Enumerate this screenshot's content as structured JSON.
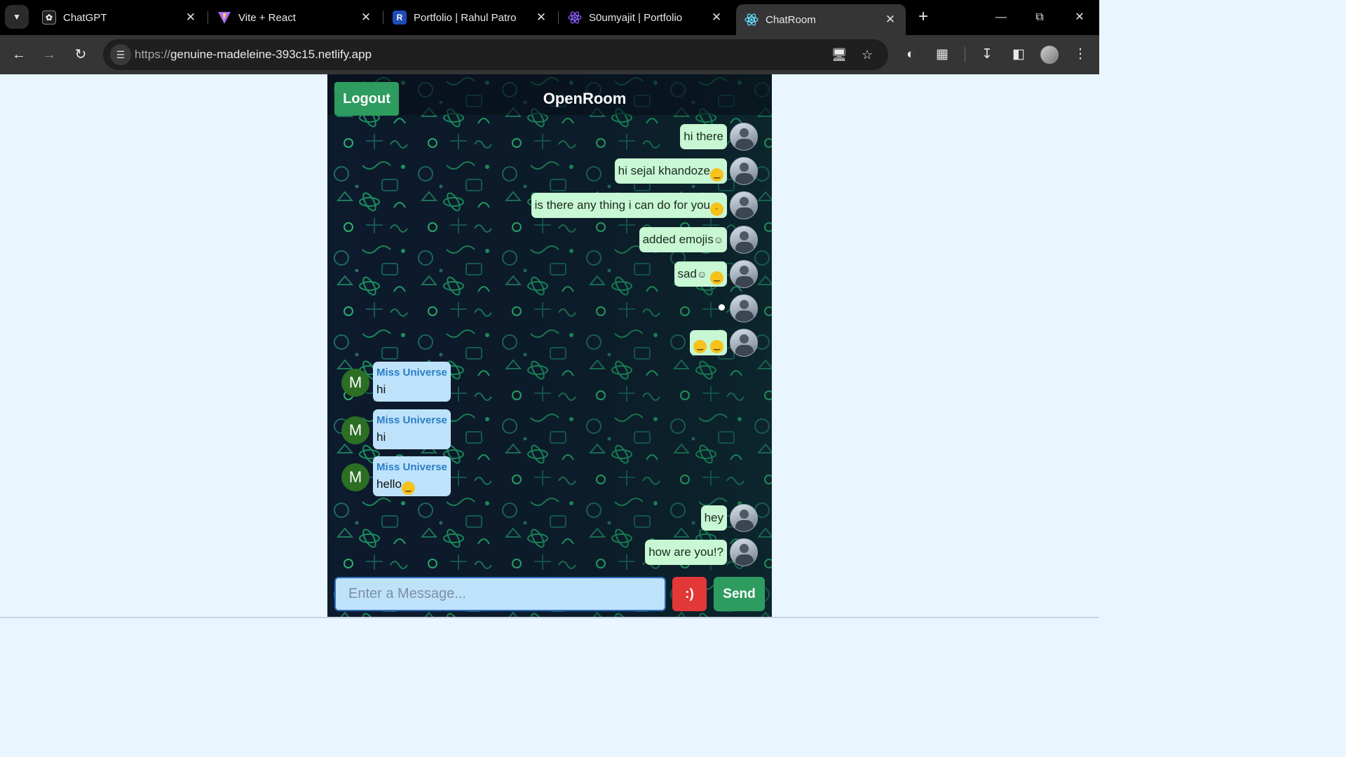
{
  "browser": {
    "tabs": [
      {
        "title": "ChatGPT",
        "icon": "chatgpt-icon",
        "active": false
      },
      {
        "title": "Vite + React",
        "icon": "vite-icon",
        "active": false
      },
      {
        "title": "Portfolio | Rahul Patro",
        "icon": "portfolio-r-icon",
        "active": false
      },
      {
        "title": "S0umyajit | Portfolio",
        "icon": "react-icon",
        "active": false
      },
      {
        "title": "ChatRoom",
        "icon": "react-icon",
        "active": true
      }
    ],
    "url_scheme": "https://",
    "url_host": "genuine-madeleine-393c15.netlify.app",
    "colors": {
      "tabbar": "#000000",
      "toolbar": "#353535",
      "omnibox": "#1f1f1f"
    }
  },
  "chat": {
    "logout_label": "Logout",
    "room_title": "OpenRoom",
    "own_messages_top": [
      {
        "text": "hi there",
        "emoji": []
      },
      {
        "text": "hi sejal khandoze",
        "emoji": [
          "grinning-face"
        ]
      },
      {
        "text": "is there any thing i can do for you",
        "emoji": [
          "thinking-face"
        ]
      },
      {
        "text": "added emojis",
        "emoji": [
          "small-smiley"
        ]
      },
      {
        "text": "sad",
        "emoji": [
          "small-smiley",
          "upside-down-face"
        ]
      },
      {
        "text": "",
        "emoji": [
          "white-dot"
        ]
      },
      {
        "text": "",
        "emoji": [
          "winking-face",
          "squinting-face"
        ]
      }
    ],
    "other_messages": [
      {
        "sender": "Miss Universe",
        "avatar_letter": "M",
        "text": "hi",
        "emoji": []
      },
      {
        "sender": "Miss Universe",
        "avatar_letter": "M",
        "text": "hi",
        "emoji": []
      },
      {
        "sender": "Miss Universe",
        "avatar_letter": "M",
        "text": "hello",
        "emoji": [
          "smiling-face-with-halo"
        ]
      }
    ],
    "own_messages_bottom": [
      {
        "text": "hey",
        "emoji": []
      },
      {
        "text": "how are you!?",
        "emoji": []
      }
    ],
    "input_placeholder": "Enter a Message...",
    "input_value": "",
    "emoji_button_label": ":)",
    "send_label": "Send",
    "colors": {
      "own_bubble": "#c8f7d3",
      "other_bubble": "#bfe2fb",
      "sender_name": "#2a7fc6",
      "logout_bg": "#2e9b5f",
      "send_bg": "#2e9b5f",
      "emoji_btn_bg": "#e23838",
      "avatar_bg": "#2c6e23",
      "page_bg": "#eaf6ff"
    }
  }
}
